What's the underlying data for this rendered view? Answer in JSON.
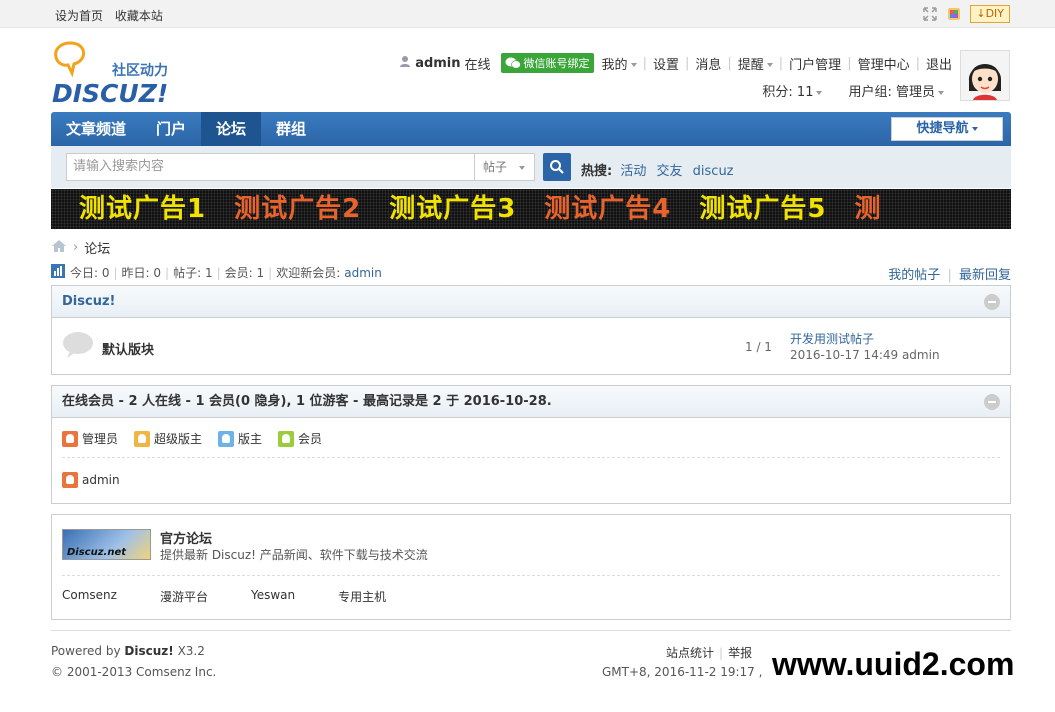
{
  "topbar": {
    "set_home": "设为首页",
    "bookmark": "收藏本站",
    "diy": "DIY"
  },
  "logo": {
    "tagline": "社区动力",
    "brand": "DISCUZ!"
  },
  "user": {
    "name": "admin",
    "status": "在线",
    "wechat": "微信账号绑定",
    "menu": [
      "我的",
      "设置",
      "消息",
      "提醒",
      "门户管理",
      "管理中心",
      "退出"
    ],
    "points": "积分: 11",
    "group": "用户组: 管理员"
  },
  "nav": {
    "items": [
      "文章频道",
      "门户",
      "论坛",
      "群组"
    ],
    "active_index": 2,
    "quick": "快捷导航"
  },
  "search": {
    "placeholder": "请输入搜索内容",
    "type": "帖子",
    "hot_label": "热搜:",
    "hot": [
      "活动",
      "交友",
      "discuz"
    ]
  },
  "ad": {
    "items": [
      "测试广告1",
      "测试广告2",
      "测试广告3",
      "测试广告4",
      "测试广告5",
      "测"
    ],
    "colors": [
      "#f2e200",
      "#e8642c",
      "#f2e200",
      "#e8642c",
      "#f2e200",
      "#e8642c"
    ]
  },
  "breadcrumb": {
    "current": "论坛"
  },
  "stats": {
    "today": "今日: 0",
    "yesterday": "昨日: 0",
    "posts": "帖子: 1",
    "members": "会员: 1",
    "newest_label": "欢迎新会员:",
    "newest": "admin",
    "my_posts": "我的帖子",
    "latest": "最新回复"
  },
  "category": {
    "title": "Discuz!",
    "forum": {
      "name": "默认版块",
      "count": "1 / 1",
      "last_title": "开发用测试帖子",
      "last_meta": "2016-10-17 14:49 admin"
    }
  },
  "online": {
    "title": "在线会员 - 2 人在线 - 1 会员(0 隐身), 1 位游客 - 最高记录是 2 于 2016-10-28.",
    "legend": [
      {
        "label": "管理员",
        "color": "#e9743d"
      },
      {
        "label": "超级版主",
        "color": "#f0b642"
      },
      {
        "label": "版主",
        "color": "#6fb3e6"
      },
      {
        "label": "会员",
        "color": "#9ccb3b"
      }
    ],
    "user": "admin"
  },
  "links": {
    "official_logo": "Discuz.net",
    "official_title": "官方论坛",
    "official_desc": "提供最新 Discuz! 产品新闻、软件下载与技术交流",
    "partners": [
      "Comsenz",
      "漫游平台",
      "Yeswan",
      "专用主机"
    ]
  },
  "footer": {
    "powered_prefix": "Powered by",
    "powered_brand": "Discuz!",
    "version": "X3.2",
    "copyright": "© 2001-2013 Comsenz Inc.",
    "links": [
      "站点统计",
      "举报"
    ],
    "gmt": "GMT+8, 2016-11-2 19:17 , P"
  },
  "watermark": "www.uuid2.com"
}
